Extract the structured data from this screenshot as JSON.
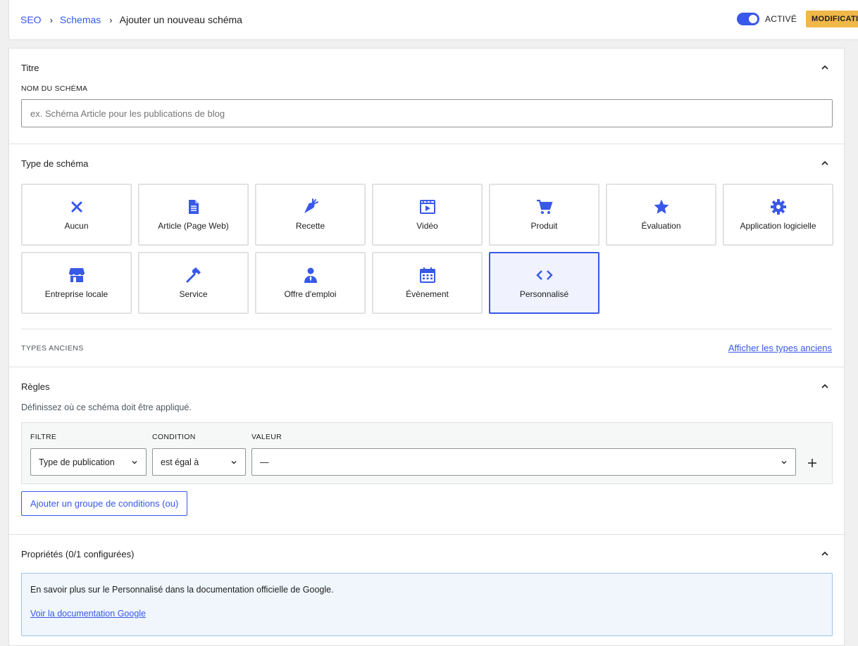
{
  "breadcrumb": {
    "root": "SEO",
    "parent": "Schemas",
    "current": "Ajouter un nouveau schéma"
  },
  "header": {
    "toggle_label": "ACTIVÉ",
    "modified_badge": "MODIFICATIONS NON ENREGISTRÉES"
  },
  "colors": {
    "accent": "#3858e9",
    "badge": "#f0b849"
  },
  "title_section": {
    "heading": "Titre",
    "field_label": "NOM DU SCHÉMA",
    "placeholder": "ex. Schéma Article pour les publications de blog"
  },
  "type_section": {
    "heading": "Type de schéma",
    "types": [
      {
        "label": "Aucun",
        "icon": "close-icon"
      },
      {
        "label": "Article (Page Web)",
        "icon": "document-icon"
      },
      {
        "label": "Recette",
        "icon": "carrot-icon"
      },
      {
        "label": "Vidéo",
        "icon": "video-icon"
      },
      {
        "label": "Produit",
        "icon": "cart-icon"
      },
      {
        "label": "Évaluation",
        "icon": "star-icon"
      },
      {
        "label": "Application logicielle",
        "icon": "gear-icon"
      },
      {
        "label": "Entreprise locale",
        "icon": "store-icon"
      },
      {
        "label": "Service",
        "icon": "hammer-icon"
      },
      {
        "label": "Offre d'emploi",
        "icon": "person-tie-icon"
      },
      {
        "label": "Évènement",
        "icon": "calendar-icon"
      },
      {
        "label": "Personnalisé",
        "icon": "code-icon",
        "selected": true
      }
    ],
    "legacy_label": "TYPES ANCIENS",
    "legacy_link": "Afficher les types anciens"
  },
  "rules_section": {
    "heading": "Règles",
    "hint": "Définissez où ce schéma doit être appliqué.",
    "filter_label": "FILTRE",
    "condition_label": "CONDITION",
    "value_label": "VALEUR",
    "filter_value": "Type de publication",
    "condition_value": "est égal à",
    "value_value": "—",
    "add_group": "Ajouter un groupe de conditions (ou)"
  },
  "properties_section": {
    "heading": "Propriétés (0/1 configurées)",
    "info_text": "En savoir plus sur le Personnalisé dans la documentation officielle de Google.",
    "info_link": "Voir la documentation Google"
  }
}
